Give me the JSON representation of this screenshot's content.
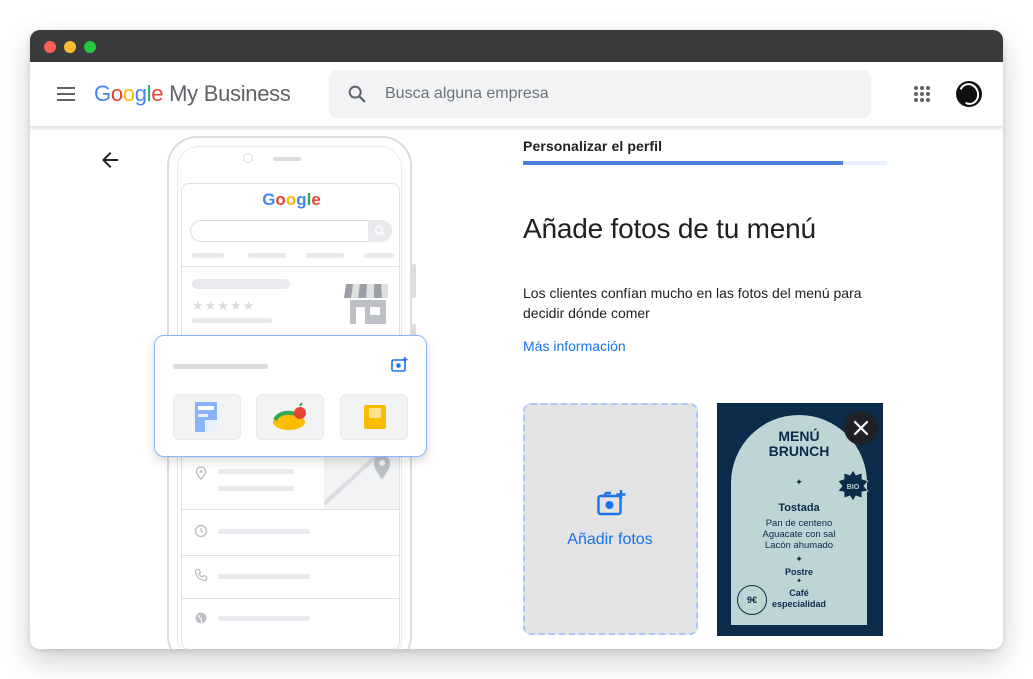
{
  "window": {
    "title_dots": [
      "close",
      "minimize",
      "maximize"
    ]
  },
  "header": {
    "menu_icon": "hamburger-menu-icon",
    "logo_google": [
      "G",
      "o",
      "o",
      "g",
      "l",
      "e"
    ],
    "logo_product": "My Business",
    "search_placeholder": "Busca alguna empresa",
    "apps_icon": "apps-grid-icon",
    "avatar_icon": "account-avatar"
  },
  "illustration": {
    "google_word": [
      "G",
      "o",
      "o",
      "g",
      "l",
      "e"
    ],
    "stars": "★★★★★"
  },
  "main": {
    "step_label": "Personalizar el perfil",
    "progress_fraction": 0.88,
    "heading": "Añade fotos de tu menú",
    "description": "Los clientes confían mucho en las fotos del menú para decidir dónde comer",
    "more_link": "Más información",
    "add_photos_label": "Añadir fotos"
  },
  "menu_photo": {
    "title_line1": "MENÚ",
    "title_line2": "BRUNCH",
    "badge": "BIO",
    "dish": "Tostada",
    "items": [
      "Pan de centeno",
      "Aguacate con sal",
      "Lacón ahumado"
    ],
    "dessert": "Postre",
    "coffee_line1": "Café",
    "coffee_line2": "especialidad",
    "price": "9€",
    "separator": "✦"
  },
  "colors": {
    "brand_blue": "#1a73e8",
    "google_blue": "#4285f4",
    "google_red": "#ea4335",
    "google_yellow": "#fbbc05",
    "google_green": "#34a853",
    "menu_bg": "#0c2b4a",
    "menu_arch": "#bfd4d4"
  }
}
